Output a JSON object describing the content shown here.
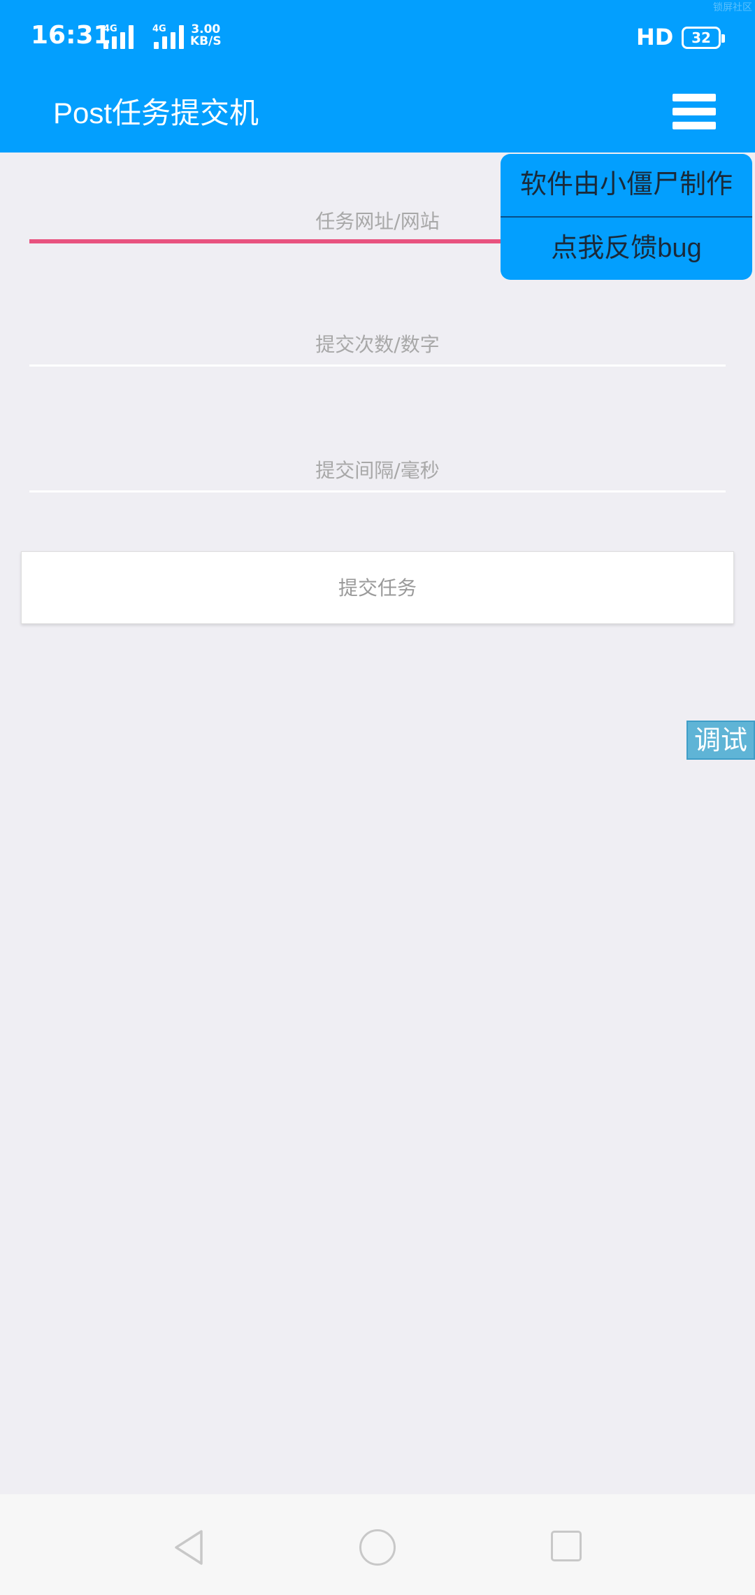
{
  "status_bar": {
    "time": "16:31",
    "network_1": "4G",
    "network_2": "4G",
    "speed_value": "3.00",
    "speed_unit": "KB/S",
    "hd_label": "HD",
    "battery": "32",
    "watermark": "锁屏社区"
  },
  "app_bar": {
    "title": "Post任务提交机",
    "menu_icon": "hamburger-menu-icon"
  },
  "form": {
    "url_placeholder": "任务网址/网站",
    "count_placeholder": "提交次数/数字",
    "interval_placeholder": "提交间隔/毫秒",
    "submit_label": "提交任务"
  },
  "popup_menu": {
    "items": [
      {
        "label": "软件由小僵尸制作"
      },
      {
        "label": "点我反馈bug"
      }
    ]
  },
  "debug_button": {
    "label": "调试"
  },
  "colors": {
    "primary": "#039ffe",
    "focus_underline": "#e8527f",
    "background": "#efeef3",
    "debug": "#5fb4d6"
  },
  "nav_bar": {
    "back_icon": "back-triangle-icon",
    "home_icon": "home-circle-icon",
    "recent_icon": "recent-apps-square-icon"
  }
}
